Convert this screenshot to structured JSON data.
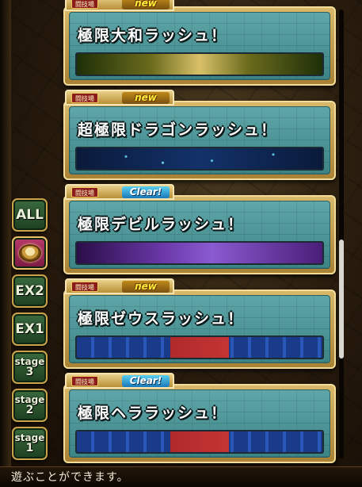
{
  "tabs": [
    {
      "id": "all",
      "label": "ALL"
    },
    {
      "id": "coliseum",
      "label": ""
    },
    {
      "id": "ex2",
      "label": "EX2"
    },
    {
      "id": "ex1",
      "label": "EX1"
    },
    {
      "id": "stage3",
      "label": "stage",
      "num": "3"
    },
    {
      "id": "stage2",
      "label": "stage",
      "num": "2"
    },
    {
      "id": "stage1",
      "label": "stage",
      "num": "1"
    }
  ],
  "cards": [
    {
      "tag": "闘技場",
      "status": "new",
      "title": "極限大和ラッシュ！"
    },
    {
      "tag": "闘技場",
      "status": "new",
      "title": "超極限ドラゴンラッシュ！"
    },
    {
      "tag": "闘技場",
      "status": "Clear!",
      "title": "極限デビルラッシュ！"
    },
    {
      "tag": "闘技場",
      "status": "new",
      "title": "極限ゼウスラッシュ！"
    },
    {
      "tag": "闘技場",
      "status": "Clear!",
      "title": "極限ヘララッシュ！"
    }
  ],
  "footer": {
    "text": "遊ぶことができます。"
  },
  "colors": {
    "accent_gold": "#c9a24a",
    "card_teal": "#4c9496",
    "tab_green": "#2a5a2e",
    "active_tab": "#a02a58"
  }
}
